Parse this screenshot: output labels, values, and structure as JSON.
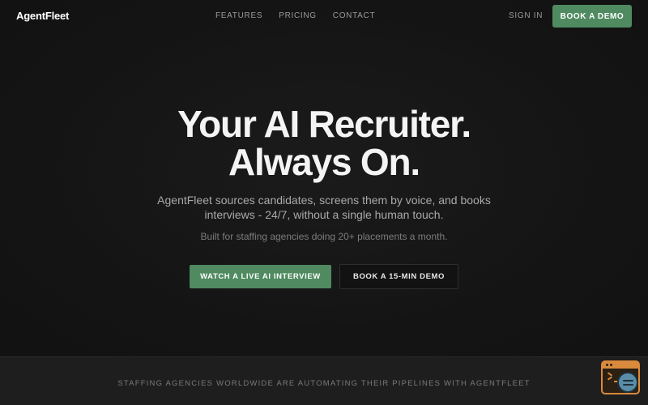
{
  "nav": {
    "logo": "AgentFleet",
    "links": [
      "FEATURES",
      "PRICING",
      "CONTACT"
    ],
    "sign_in": "SIGN IN",
    "cta": "BOOK A DEMO"
  },
  "hero": {
    "title_line1": "Your AI Recruiter.",
    "title_line2": "Always On.",
    "subtitle": "AgentFleet sources candidates, screens them by voice, and books interviews - 24/7, without a single human touch.",
    "note": "Built for staffing agencies doing 20+ placements a month.",
    "primary_button": "WATCH A LIVE AI INTERVIEW",
    "secondary_button": "BOOK A 15-MIN DEMO"
  },
  "band": {
    "text": "STAFFING AGENCIES WORLDWIDE ARE AUTOMATING THEIR PIPELINES WITH AGENTFLEET"
  },
  "widget": {
    "icon": "browser-search-icon"
  },
  "colors": {
    "accent": "#4f8a60",
    "background": "#141414",
    "widget": "#d98a3c"
  }
}
